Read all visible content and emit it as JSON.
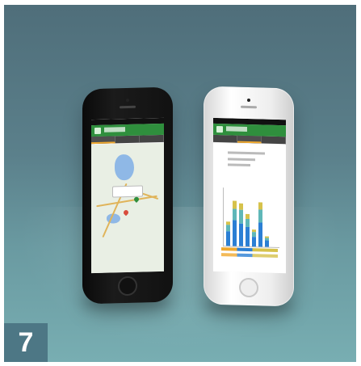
{
  "badge": {
    "label": "7"
  }
}
